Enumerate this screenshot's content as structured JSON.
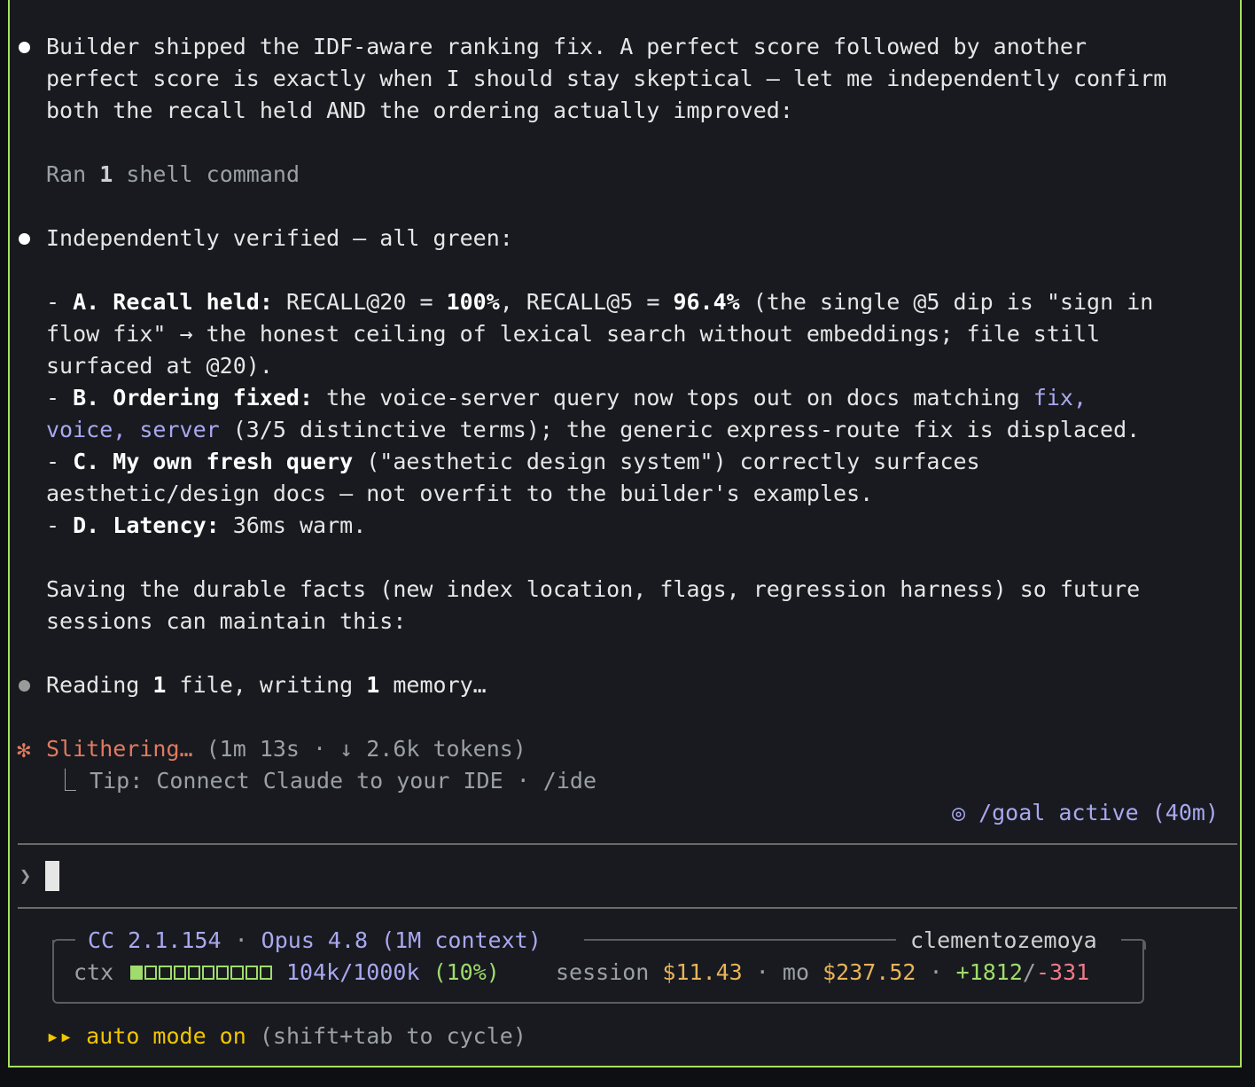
{
  "messages": {
    "m1_line1": "Builder shipped the IDF-aware ranking fix. A perfect score followed by another",
    "m1_line2": "perfect score is exactly when I should stay skeptical — let me independently confirm",
    "m1_line3": "both the recall held AND the ordering actually improved:",
    "ran_prefix": "Ran ",
    "ran_count": "1",
    "ran_suffix": " shell command",
    "m2_line1": "Independently verified — all green:",
    "a_prefix": "- ",
    "a_label": "A. Recall held:",
    "a_text1": " RECALL@20 = ",
    "a_val1": "100%",
    "a_text2": ", RECALL@5 = ",
    "a_val2": "96.4%",
    "a_text3": " (the single @5 dip is \"sign in",
    "a_line2": "flow fix\" → the honest ceiling of lexical search without embeddings; file still",
    "a_line3": "surfaced at @20).",
    "b_prefix": "- ",
    "b_label": "B. Ordering fixed:",
    "b_text1": " the voice-server query now tops out on docs matching ",
    "b_link1": "fix,",
    "b_link2": "voice, server",
    "b_text2": " (3/5 distinctive terms); the generic express-route fix is displaced.",
    "c_prefix": "- ",
    "c_label": "C. My own fresh query",
    "c_text1": " (\"aesthetic design system\") correctly surfaces",
    "c_line2": "aesthetic/design docs — not overfit to the builder's examples.",
    "d_prefix": "- ",
    "d_label": "D. Latency:",
    "d_text": " 36ms warm.",
    "save_line1": "Saving the durable facts (new index location, flags, regression harness) so future",
    "save_line2": "sessions can maintain this:",
    "reading_prefix": "Reading ",
    "reading_n1": "1",
    "reading_mid": " file, writing ",
    "reading_n2": "1",
    "reading_suffix": " memory…"
  },
  "activity": {
    "star": "✻",
    "verb": "Slithering…",
    "detail": " (1m 13s · ↓ 2.6k tokens)",
    "tip_branch": "⎿",
    "tip": " Tip: Connect Claude to your IDE · /ide",
    "goal": "◎ /goal active (40m)"
  },
  "prompt": {
    "caret": "❯"
  },
  "status": {
    "cc": "CC 2.1.154",
    "sep1": " · ",
    "model": "Opus 4.8 (1M context)",
    "user": "clementozemoya",
    "ctx_label": "ctx",
    "ctx_fill_fraction": 0.1,
    "ctx_value": "104k/1000k",
    "ctx_pct": "(10%)",
    "session_label": "session",
    "session_cost": "$11.43",
    "dot": "·",
    "mo_label": "mo",
    "mo_cost": "$237.52",
    "added": "+1812",
    "slash": "/",
    "removed": "-331"
  },
  "footer": {
    "arrows": "▸▸",
    "mode": "auto mode on",
    "hint": " (shift+tab to cycle)"
  },
  "colors": {
    "border": "#a8e05f",
    "accent_purple": "#a9a8f0",
    "spinner": "#e07a5f",
    "mode_yellow": "#f2c500"
  }
}
